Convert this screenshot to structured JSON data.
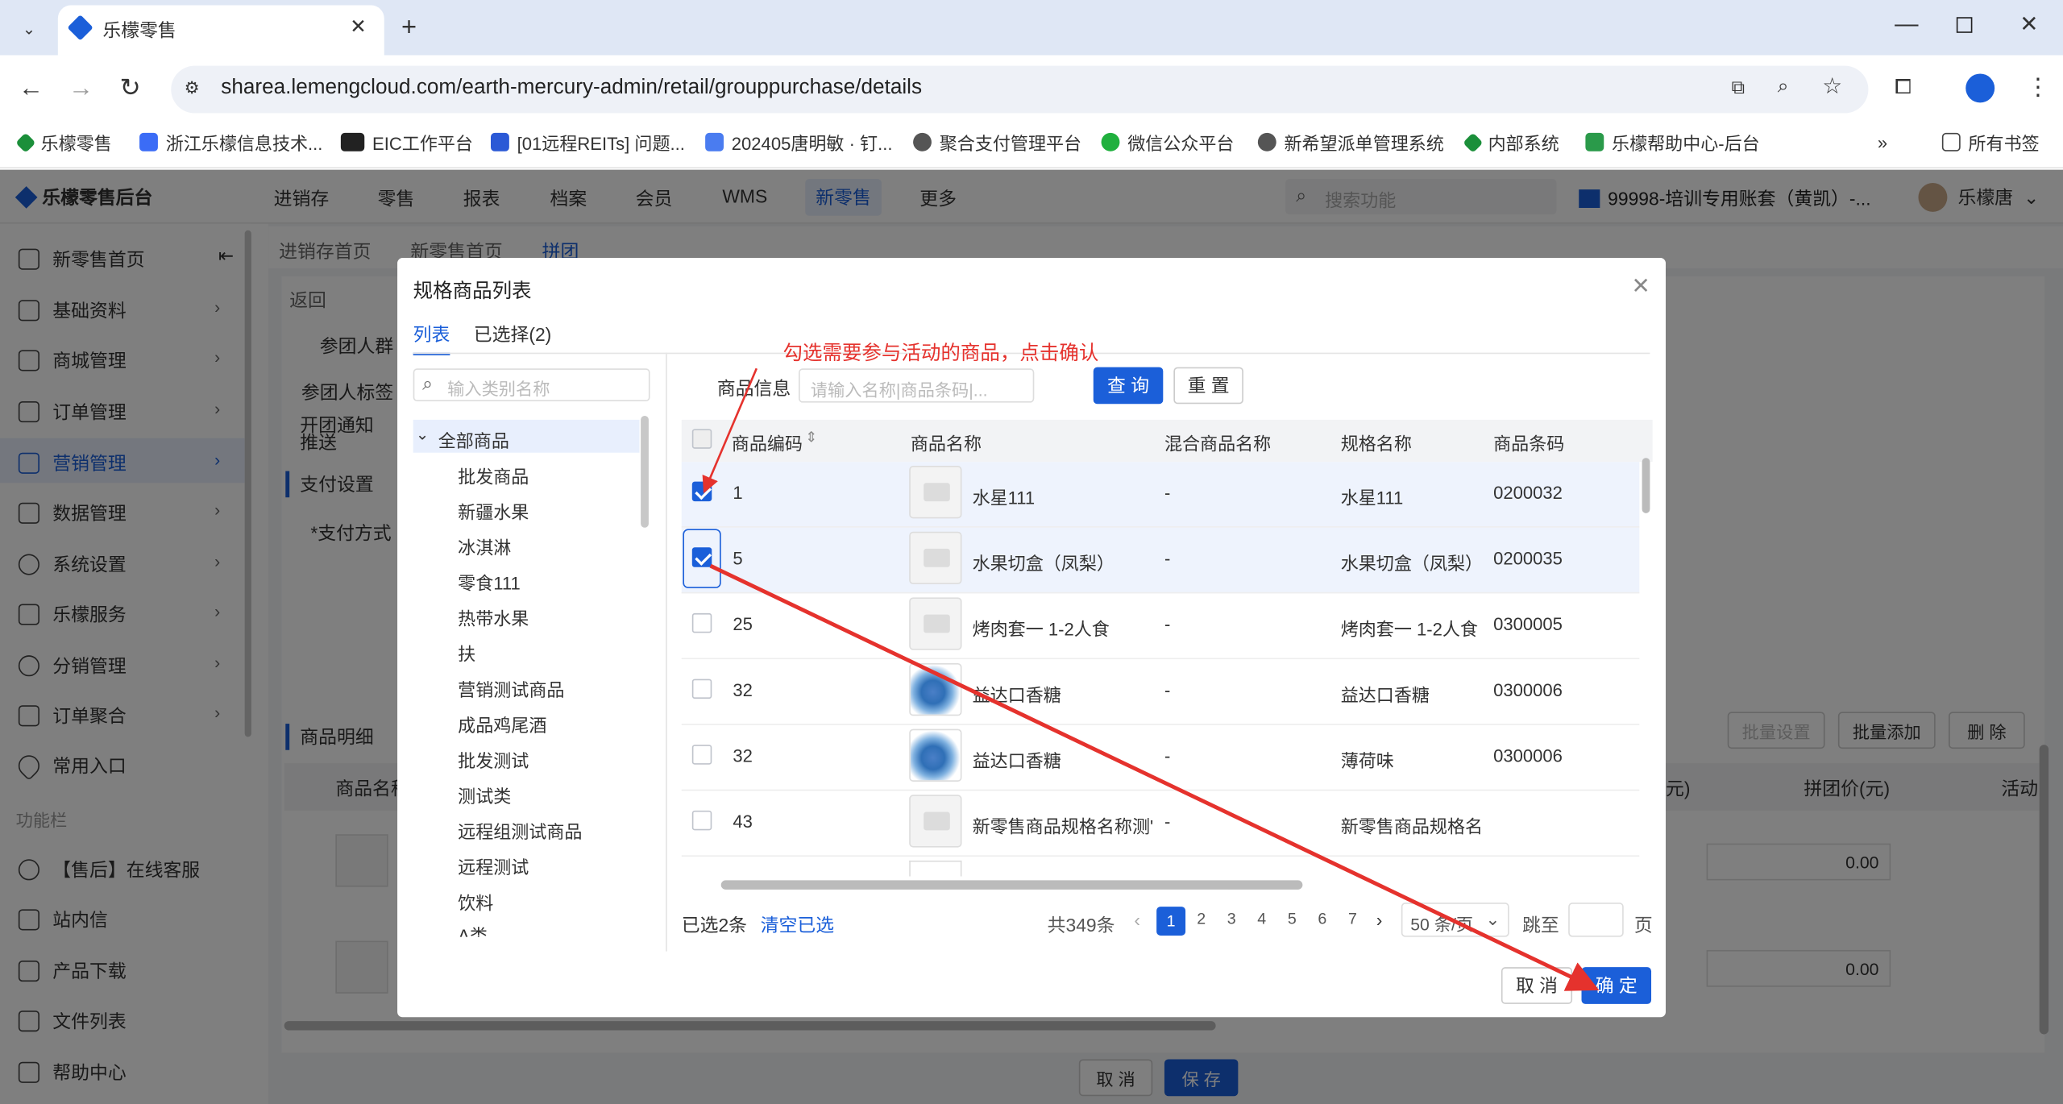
{
  "browser": {
    "tab_title": "乐檬零售",
    "url": "sharea.lemengcloud.com/earth-mercury-admin/retail/grouppurchase/details",
    "bookmarks": [
      "乐檬零售",
      "浙江乐檬信息技术...",
      "EIC工作平台",
      "[01远程REITs] 问题...",
      "202405唐明敏 · 钉...",
      "聚合支付管理平台",
      "微信公众平台",
      "新希望派单管理系统",
      "内部系统",
      "乐檬帮助中心-后台"
    ],
    "all_bookmarks": "所有书签"
  },
  "app": {
    "logo": "乐檬零售后台",
    "nav": [
      "进销存",
      "零售",
      "报表",
      "档案",
      "会员",
      "WMS",
      "新零售",
      "更多"
    ],
    "search_placeholder": "搜索功能",
    "account": "99998-培训专用账套（黄凯）-...",
    "user": "乐檬唐",
    "sidebar": [
      "新零售首页",
      "基础资料",
      "商城管理",
      "订单管理",
      "营销管理",
      "数据管理",
      "系统设置",
      "乐檬服务",
      "分销管理",
      "订单聚合",
      "常用入口"
    ],
    "sidebar_section": "功能栏",
    "sidebar2": [
      "【售后】在线客服",
      "站内信",
      "产品下载",
      "文件列表",
      "帮助中心"
    ],
    "page_tabs": [
      "进销存首页",
      "新零售首页",
      "拼团"
    ],
    "back": "返回",
    "form_labels": [
      "参团人群",
      "参团人标签",
      "开团通知推送",
      "支付设置",
      "*支付方式",
      "商品明细"
    ],
    "buttons": [
      "批量设置",
      "批量添加",
      "删 除"
    ],
    "col_headers": [
      "商品名称",
      "元)",
      "拼团价(元)",
      "活动"
    ],
    "prices": [
      "0.00",
      "0.00"
    ],
    "footer": [
      "取 消",
      "保 存"
    ]
  },
  "modal": {
    "title": "规格商品列表",
    "tabs": [
      "列表",
      "已选择(2)"
    ],
    "cat_placeholder": "输入类别名称",
    "categories": [
      "全部商品",
      "批发商品",
      "新疆水果",
      "冰淇淋",
      "零食111",
      "热带水果",
      "扶",
      "营销测试商品",
      "成品鸡尾酒",
      "批发测试",
      "测试类",
      "远程组测试商品",
      "远程测试",
      "饮料",
      "A类"
    ],
    "filter_label": "商品信息",
    "filter_placeholder": "请输入名称|商品条码|...",
    "query": "查 询",
    "reset": "重 置",
    "columns": [
      "商品编码",
      "商品名称",
      "混合商品名称",
      "规格名称",
      "商品条码"
    ],
    "rows": [
      {
        "code": "1",
        "name": "水星111",
        "mixed": "-",
        "spec": "水星111",
        "barcode": "0200032",
        "checked": true
      },
      {
        "code": "5",
        "name": "水果切盒（凤梨）",
        "mixed": "-",
        "spec": "水果切盒（凤梨）",
        "barcode": "0200035",
        "checked": true
      },
      {
        "code": "25",
        "name": "烤肉套一 1-2人食",
        "mixed": "-",
        "spec": "烤肉套一 1-2人食",
        "barcode": "0300005",
        "checked": false
      },
      {
        "code": "32",
        "name": "益达口香糖",
        "mixed": "-",
        "spec": "益达口香糖",
        "barcode": "0300006",
        "checked": false
      },
      {
        "code": "32",
        "name": "益达口香糖",
        "mixed": "-",
        "spec": "薄荷味",
        "barcode": "0300006",
        "checked": false
      },
      {
        "code": "43",
        "name": "新零售商品规格名称测'",
        "mixed": "-",
        "spec": "新零售商品规格名",
        "barcode": "",
        "checked": false
      }
    ],
    "selected_count": "已选2条",
    "clear": "清空已选",
    "total": "共349条",
    "pages": [
      "1",
      "2",
      "3",
      "4",
      "5",
      "6",
      "7"
    ],
    "page_size": "50 条/页",
    "jump": "跳至",
    "page_unit": "页",
    "cancel": "取 消",
    "confirm": "确 定"
  },
  "annotation": "勾选需要参与活动的商品，点击确认",
  "colors": {
    "accent": "#1b5fd9",
    "annotation": "#e5322d"
  }
}
